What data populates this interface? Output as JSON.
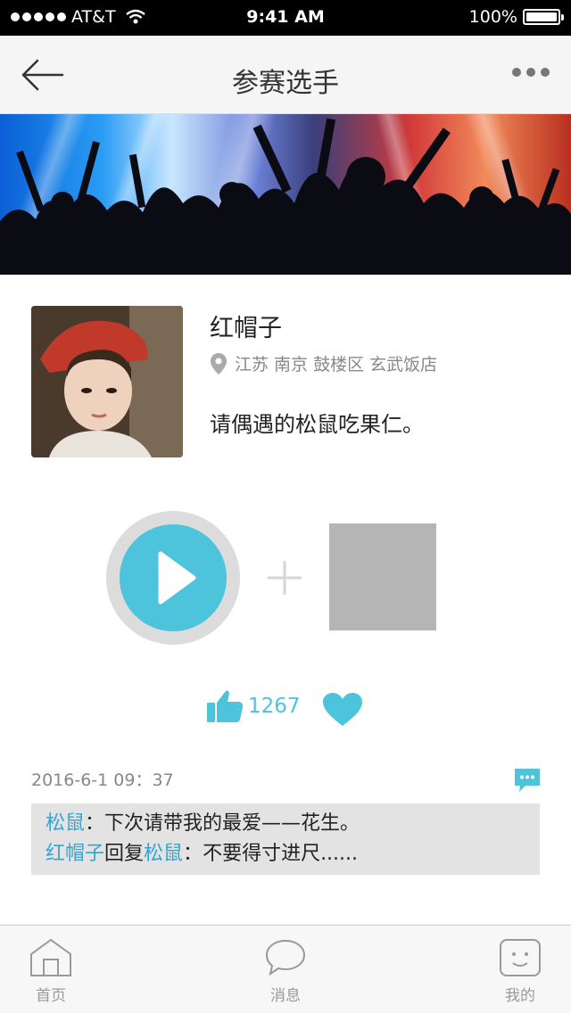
{
  "status_bar": {
    "carrier": "AT&T",
    "time": "9:41 AM",
    "battery": "100%"
  },
  "nav": {
    "title": "参赛选手"
  },
  "profile": {
    "name": "红帽子",
    "location": "江苏 南京 鼓楼区 玄武饭店",
    "bio": "请偶遇的松鼠吃果仁。"
  },
  "likes": {
    "count": "1267"
  },
  "comment_section": {
    "timestamp": "2016-6-1  09：37",
    "comments": [
      {
        "user": "松鼠",
        "separator": "：",
        "text": "下次请带我的最爱——花生。"
      },
      {
        "user": "红帽子",
        "reply_word": "回复",
        "reply_to": "松鼠",
        "separator": "：",
        "text": "不要得寸进尺......"
      }
    ]
  },
  "tab_bar": {
    "items": [
      {
        "label": "首页",
        "icon": "home-icon"
      },
      {
        "label": "消息",
        "icon": "message-icon"
      },
      {
        "label": "我的",
        "icon": "profile-icon"
      }
    ]
  },
  "colors": {
    "accent": "#4ec3dc",
    "comment_user": "#3aa3cf",
    "placeholder": "#b5b5b5"
  }
}
